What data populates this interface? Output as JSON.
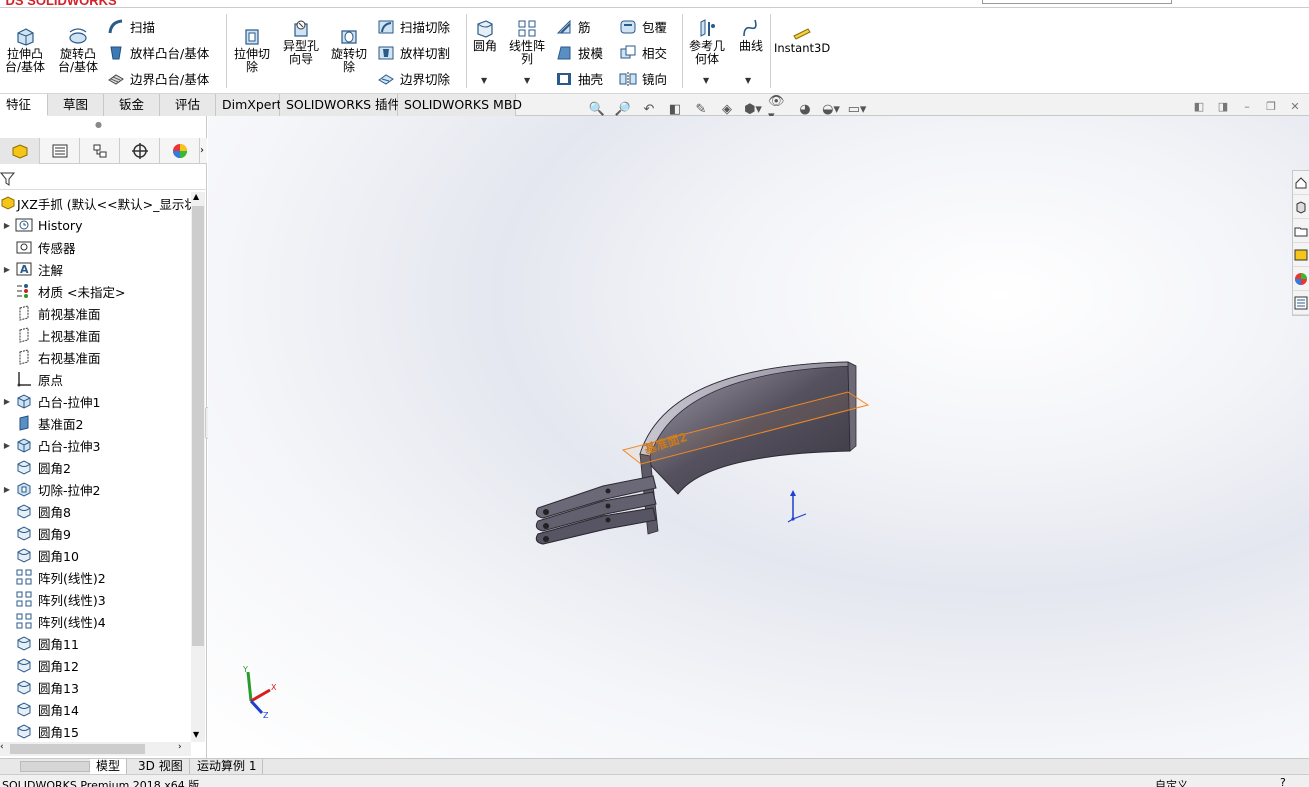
{
  "app": {
    "logo_text": "SOLIDWORKS"
  },
  "ribbon": {
    "extrude_boss": "拉伸凸\n台/基体",
    "revolve_boss": "旋转凸\n台/基体",
    "sweep": "扫描",
    "loft_boss": "放样凸台/基体",
    "boundary_boss": "边界凸台/基体",
    "extrude_cut": "拉伸切\n除",
    "hole_wizard": "异型孔\n向导",
    "revolve_cut": "旋转切\n除",
    "swept_cut": "扫描切除",
    "lofted_cut": "放样切割",
    "boundary_cut": "边界切除",
    "fillet": "圆角",
    "linear_pattern": "线性阵\n列",
    "rib": "筋",
    "draft": "拔模",
    "shell": "抽壳",
    "wrap": "包覆",
    "intersect": "相交",
    "mirror": "镜向",
    "ref_geometry": "参考几\n何体",
    "curves": "曲线",
    "instant3d": "Instant3D"
  },
  "tabs": [
    "特征",
    "草图",
    "钣金",
    "评估",
    "DimXpert",
    "SOLIDWORKS 插件",
    "SOLIDWORKS MBD"
  ],
  "tree": {
    "root": "JXZ手抓  (默认<<默认>_显示状",
    "items": [
      {
        "label": "History",
        "icon": "history-icon",
        "exp": true
      },
      {
        "label": "传感器",
        "icon": "sensor-icon",
        "exp": false
      },
      {
        "label": "注解",
        "icon": "annotation-icon",
        "exp": true
      },
      {
        "label": "材质 <未指定>",
        "icon": "material-icon",
        "exp": false
      },
      {
        "label": "前视基准面",
        "icon": "plane-icon",
        "exp": false
      },
      {
        "label": "上视基准面",
        "icon": "plane-icon",
        "exp": false
      },
      {
        "label": "右视基准面",
        "icon": "plane-icon",
        "exp": false
      },
      {
        "label": "原点",
        "icon": "origin-icon",
        "exp": false
      },
      {
        "label": "凸台-拉伸1",
        "icon": "extrude-icon",
        "exp": true
      },
      {
        "label": "基准面2",
        "icon": "plane-solid-icon",
        "exp": false
      },
      {
        "label": "凸台-拉伸3",
        "icon": "extrude-icon",
        "exp": true
      },
      {
        "label": "圆角2",
        "icon": "fillet-icon",
        "exp": false
      },
      {
        "label": "切除-拉伸2",
        "icon": "cut-icon",
        "exp": true
      },
      {
        "label": "圆角8",
        "icon": "fillet-icon",
        "exp": false
      },
      {
        "label": "圆角9",
        "icon": "fillet-icon",
        "exp": false
      },
      {
        "label": "圆角10",
        "icon": "fillet-icon",
        "exp": false
      },
      {
        "label": "阵列(线性)2",
        "icon": "pattern-icon",
        "exp": false
      },
      {
        "label": "阵列(线性)3",
        "icon": "pattern-icon",
        "exp": false
      },
      {
        "label": "阵列(线性)4",
        "icon": "pattern-icon",
        "exp": false
      },
      {
        "label": "圆角11",
        "icon": "fillet-icon",
        "exp": false
      },
      {
        "label": "圆角12",
        "icon": "fillet-icon",
        "exp": false
      },
      {
        "label": "圆角13",
        "icon": "fillet-icon",
        "exp": false
      },
      {
        "label": "圆角14",
        "icon": "fillet-icon",
        "exp": false
      },
      {
        "label": "圆角15",
        "icon": "fillet-icon",
        "exp": false
      }
    ]
  },
  "viewport": {
    "plane_label": "基准面2",
    "triad_x": "X",
    "triad_y": "Y",
    "triad_z": "Z"
  },
  "bottom_tabs": [
    "模型",
    "3D 视图",
    "运动算例 1"
  ],
  "status": {
    "left": "SOLIDWORKS Premium 2018 x64 版",
    "right": "自定义"
  }
}
